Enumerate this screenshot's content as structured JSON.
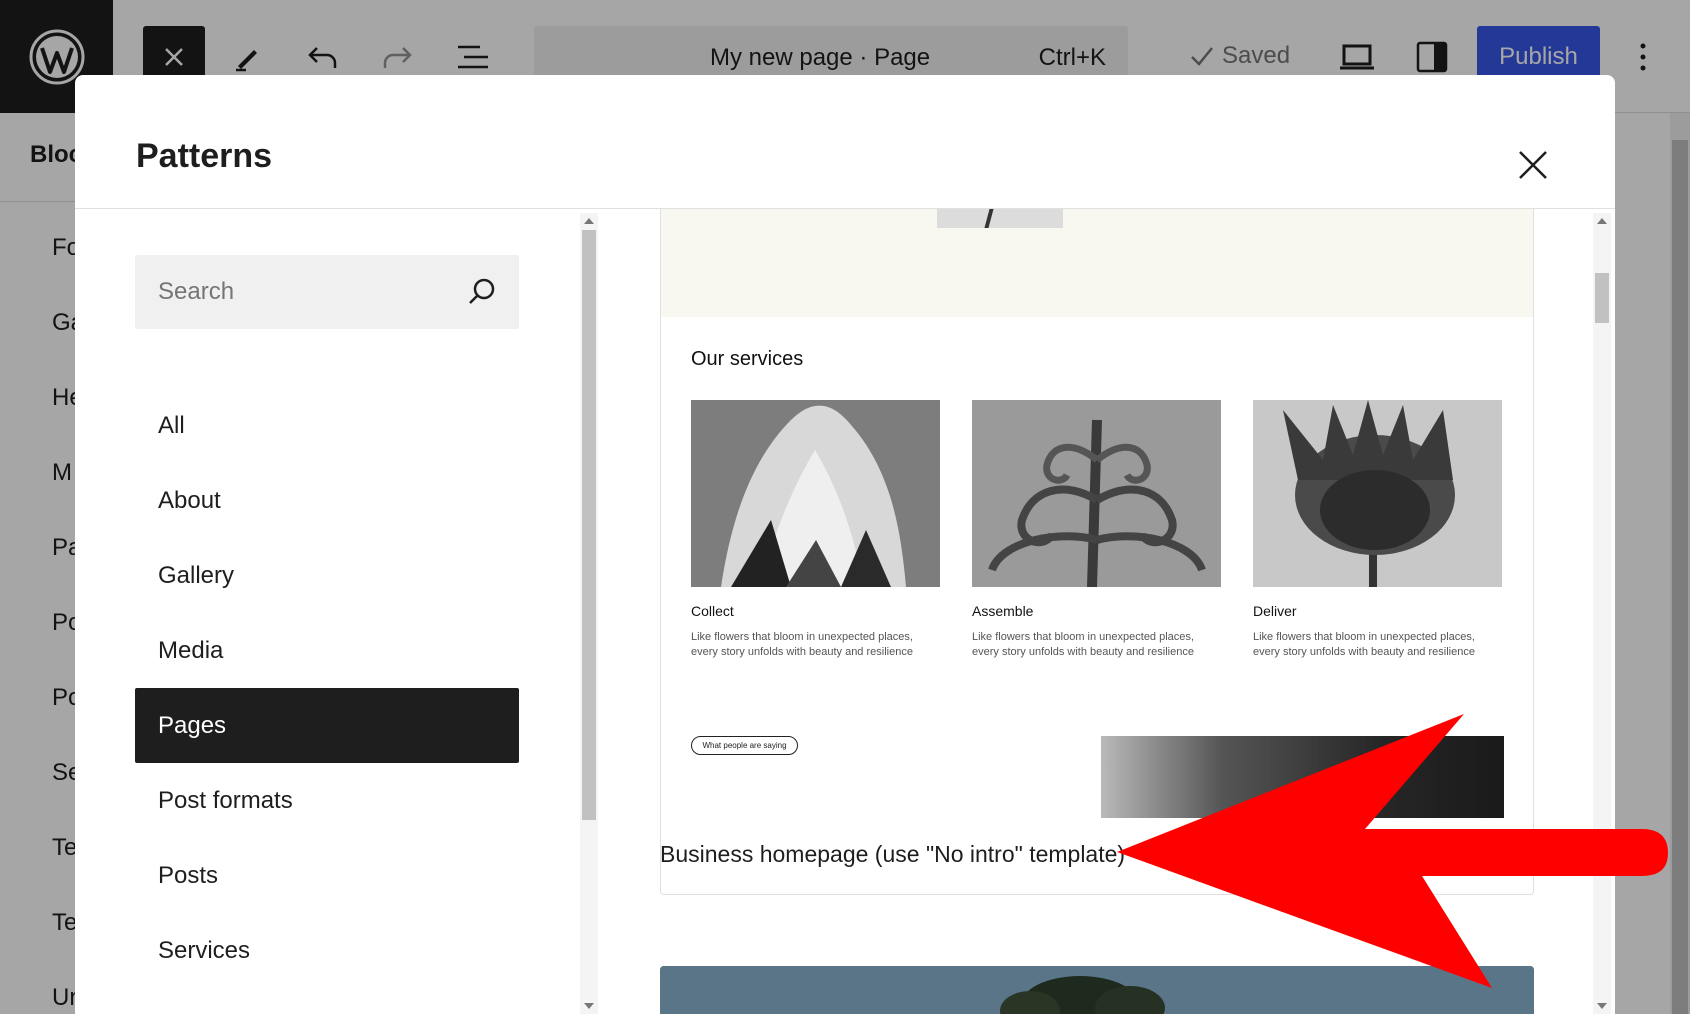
{
  "editor": {
    "page_title": "My new page · Page",
    "shortcut": "Ctrl+K",
    "saved_label": "Saved",
    "publish_label": "Publish"
  },
  "left_panel": {
    "tab_label": "Bloc",
    "items": [
      "Fo",
      "Ga",
      "He",
      "M",
      "Pa",
      "Po",
      "Po",
      "Se",
      "Te",
      "Te",
      "Ur"
    ]
  },
  "modal": {
    "title": "Patterns",
    "search_placeholder": "Search",
    "categories": [
      {
        "label": "All",
        "active": false
      },
      {
        "label": "About",
        "active": false
      },
      {
        "label": "Gallery",
        "active": false
      },
      {
        "label": "Media",
        "active": false
      },
      {
        "label": "Pages",
        "active": true
      },
      {
        "label": "Post formats",
        "active": false
      },
      {
        "label": "Posts",
        "active": false
      },
      {
        "label": "Services",
        "active": false
      }
    ]
  },
  "pattern": {
    "services_title": "Our services",
    "services": [
      {
        "name": "Collect",
        "desc": "Like flowers that bloom in unexpected places, every story unfolds with beauty and resilience"
      },
      {
        "name": "Assemble",
        "desc": "Like flowers that bloom in unexpected places, every story unfolds with beauty and resilience"
      },
      {
        "name": "Deliver",
        "desc": "Like flowers that bloom in unexpected places, every story unfolds with beauty and resilience"
      }
    ],
    "testimonial_pill": "What people are saying",
    "label": "Business homepage (use \"No intro\" template)"
  },
  "colors": {
    "accent": "#3858e9",
    "dark": "#1e1e1e",
    "annotation": "#ff0000"
  },
  "icons": [
    "wordpress-logo",
    "close-icon",
    "pencil-icon",
    "undo-icon",
    "redo-icon",
    "list-view-icon",
    "check-icon",
    "desktop-view-icon",
    "sidebar-settings-icon",
    "more-vertical-icon",
    "search-icon"
  ]
}
